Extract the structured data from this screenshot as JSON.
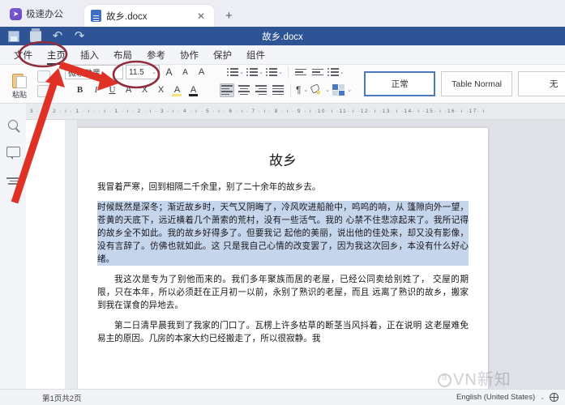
{
  "window": {
    "brand": "极速办公",
    "brand_icon": "paper-plane-icon",
    "doc_tab_label": "故乡.docx",
    "tab_close": "✕",
    "tab_new": "+",
    "title": "故乡.docx"
  },
  "quick_access": {
    "save": "save-icon",
    "print": "print-icon",
    "undo": "↶",
    "redo": "↷"
  },
  "menu": {
    "items": [
      {
        "label": "文件",
        "active": false
      },
      {
        "label": "主页",
        "active": true
      },
      {
        "label": "插入",
        "active": false
      },
      {
        "label": "布局",
        "active": false
      },
      {
        "label": "参考",
        "active": false
      },
      {
        "label": "协作",
        "active": false
      },
      {
        "label": "保护",
        "active": false
      },
      {
        "label": "组件",
        "active": false
      }
    ]
  },
  "ribbon": {
    "paste_label": "粘贴",
    "font_name": "微软雅黑",
    "font_size": "11.5",
    "grow_font": "A",
    "shrink_font": "A",
    "clear_format": "A",
    "bold": "B",
    "italic": "I",
    "underline": "U",
    "strike": "A",
    "subscript": "X",
    "superscript": "X",
    "highlight": "A",
    "font_color": "A",
    "caret": "⌄",
    "pilcrow": "¶",
    "styles": [
      {
        "label": "正常",
        "active": true
      },
      {
        "label": "Table Normal",
        "active": false
      },
      {
        "label": "无",
        "active": false
      }
    ]
  },
  "rail": {
    "items": [
      {
        "name": "search-icon"
      },
      {
        "name": "comment-icon"
      },
      {
        "name": "outline-icon"
      }
    ]
  },
  "ruler": {
    "corner": "L",
    "ticks": "3 · ı · 2 · ı · 1 · ı ·  · ı · 1 · ı · 2 · ı · 3 · ı · 4 · ı · 5 · ı · 6 · ı · 7 · ı · 8 · ı · 9 · ı ·10· ı ·11· ı ·12· ı ·13· ı ·14· ı ·15· ı ·16· ı ·17· ı"
  },
  "document": {
    "title": "故乡",
    "paragraphs": [
      {
        "id": "p1",
        "selected": false,
        "indent": false,
        "text": "我冒着严寒，回到相隔二千余里，别了二十余年的故乡去。"
      },
      {
        "id": "p2",
        "selected": true,
        "indent": false,
        "text": "时候既然是深冬；渐近故乡时，天气又阴晦了，冷风吹进船舱中，呜呜的响，从 篷隙向外一望，苍黄的天底下，远近横着几个萧索的荒村，没有一些活气。我的 心禁不住悲凉起来了。我所记得的故乡全不如此。我的故乡好得多了。但要我记 起他的美丽，说出他的佳处来，却又没有影像，没有言辞了。仿佛也就如此。这 只是我自己心情的改变罢了，因为我这次回乡，本没有什么好心绪。"
      },
      {
        "id": "p3",
        "selected": false,
        "indent": true,
        "text": "我这次是专为了别他而来的。我们多年聚族而居的老屋，已经公同卖给别姓了， 交屋的期限，只在本年，所以必须赶在正月初一以前，永别了熟识的老屋，而且 远离了熟识的故乡，搬家到我在谋食的异地去。"
      },
      {
        "id": "p4",
        "selected": false,
        "indent": true,
        "text": "第二日清早晨我到了我家的门口了。瓦楞上许多枯草的断茎当风抖着，正在说明 这老屋难免易主的原因。几房的本家大约已经搬走了，所以很寂静。我"
      }
    ],
    "watermark": "VN新知"
  },
  "status": {
    "pages": "第1页共2页",
    "language": "English (United States)",
    "language_caret": "⌄",
    "globe_icon": "globe-icon"
  },
  "annotations": {
    "accent_color": "#e03127",
    "circle_color": "#8f2d3d",
    "arrow1_target": "主页",
    "arrow2_target": "11.5"
  }
}
